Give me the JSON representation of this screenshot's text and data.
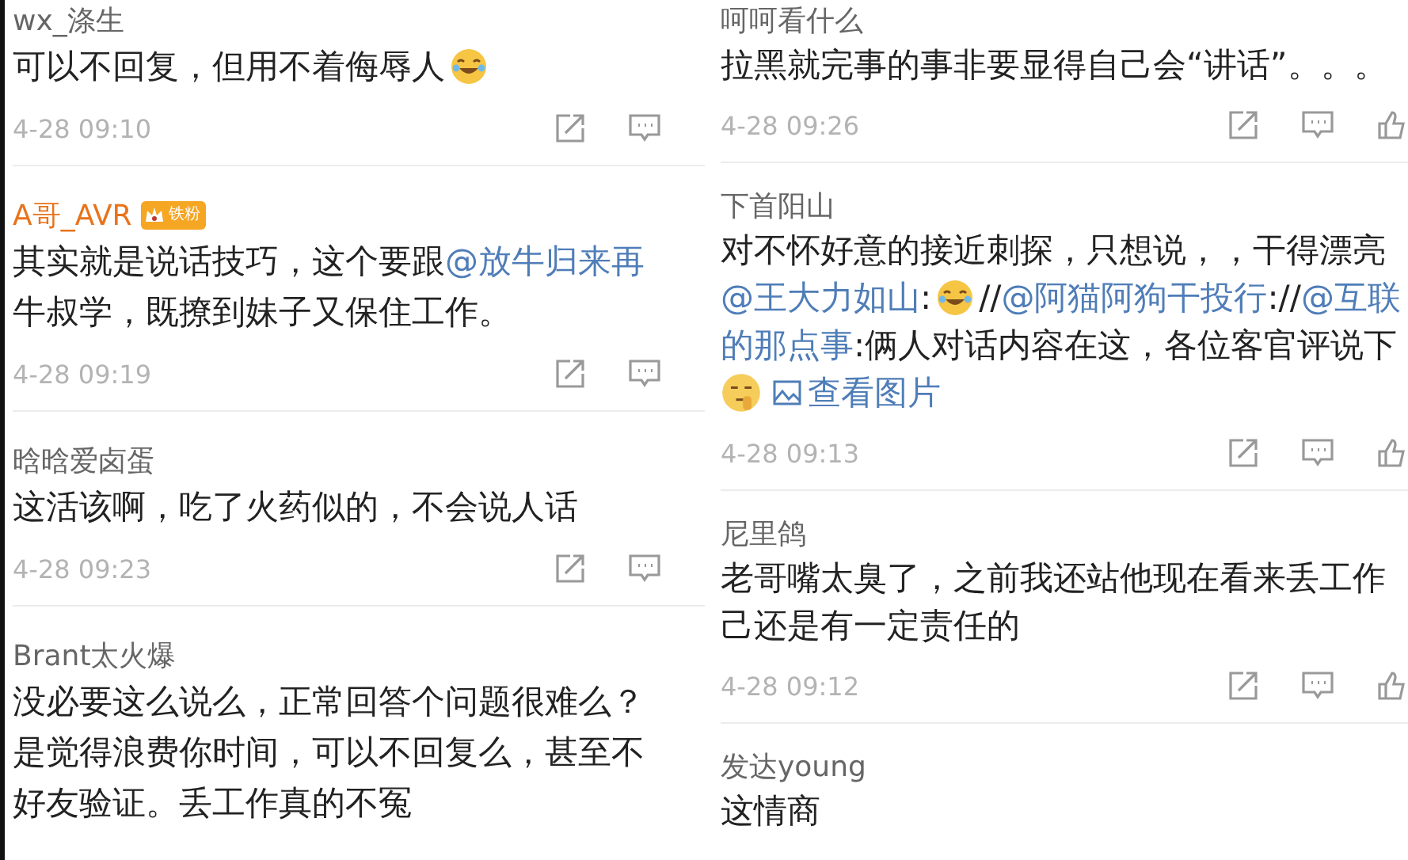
{
  "panels": [
    {
      "show_like": false,
      "comments": [
        {
          "name": "wx_涤生",
          "vip": false,
          "lines": [
            [
              {
                "kind": "text",
                "text": "可以不回复，但用不着侮辱人"
              },
              {
                "kind": "emoji_laugh"
              }
            ]
          ],
          "time": "4-28 09:10"
        },
        {
          "name": "A哥_AVR",
          "vip": true,
          "badge": "铁粉",
          "lines": [
            [
              {
                "kind": "text",
                "text": "其实就是说话技巧，这个要跟"
              },
              {
                "kind": "mention",
                "text": "@放牛归来再"
              }
            ],
            [
              {
                "kind": "text",
                "text": "牛叔学，既撩到妹子又保住工作。"
              }
            ]
          ],
          "time": "4-28 09:19"
        },
        {
          "name": "晗晗爱卤蛋",
          "vip": false,
          "lines": [
            [
              {
                "kind": "text",
                "text": "这活该啊，吃了火药似的，不会说人话"
              }
            ]
          ],
          "time": "4-28 09:23"
        },
        {
          "name": "Brant太火爆",
          "vip": false,
          "lines": [
            [
              {
                "kind": "text",
                "text": "没必要这么说么，正常回答个问题很难么？"
              }
            ],
            [
              {
                "kind": "text",
                "text": "是觉得浪费你时间，可以不回复么，甚至不"
              }
            ],
            [
              {
                "kind": "text",
                "text": "好友验证。丢工作真的不冤"
              }
            ]
          ]
        }
      ]
    },
    {
      "show_like": true,
      "comments": [
        {
          "name": "呵呵看什么",
          "vip": false,
          "lines": [
            [
              {
                "kind": "text",
                "text": "拉黑就完事的事非要显得自己会“讲话”。。。"
              }
            ]
          ],
          "time": "4-28 09:26"
        },
        {
          "name": "下首阳山",
          "vip": false,
          "lines": [
            [
              {
                "kind": "text",
                "text": "对不怀好意的接近刺探，只想说，，干得漂亮"
              }
            ],
            [
              {
                "kind": "mention",
                "text": "@王大力如山"
              },
              {
                "kind": "text",
                "text": ":"
              },
              {
                "kind": "emoji_laugh"
              },
              {
                "kind": "text",
                "text": "//"
              },
              {
                "kind": "mention",
                "text": "@阿猫阿狗干投行"
              },
              {
                "kind": "text",
                "text": "://"
              },
              {
                "kind": "mention",
                "text": "@互联"
              }
            ],
            [
              {
                "kind": "mention",
                "text": "的那点事"
              },
              {
                "kind": "text",
                "text": ":俩人对话内容在这，各位客官评说下"
              }
            ],
            [
              {
                "kind": "emoji_hush"
              },
              {
                "kind": "link",
                "text": "查看图片"
              }
            ]
          ],
          "time": "4-28 09:13"
        },
        {
          "name": "尼里鸽",
          "vip": false,
          "lines": [
            [
              {
                "kind": "text",
                "text": "老哥嘴太臭了，之前我还站他现在看来丢工作"
              }
            ],
            [
              {
                "kind": "text",
                "text": "己还是有一定责任的"
              }
            ]
          ],
          "time": "4-28 09:12"
        },
        {
          "name": "发达young",
          "vip": false,
          "lines": [
            [
              {
                "kind": "text",
                "text": "这情商"
              }
            ]
          ]
        }
      ]
    }
  ]
}
